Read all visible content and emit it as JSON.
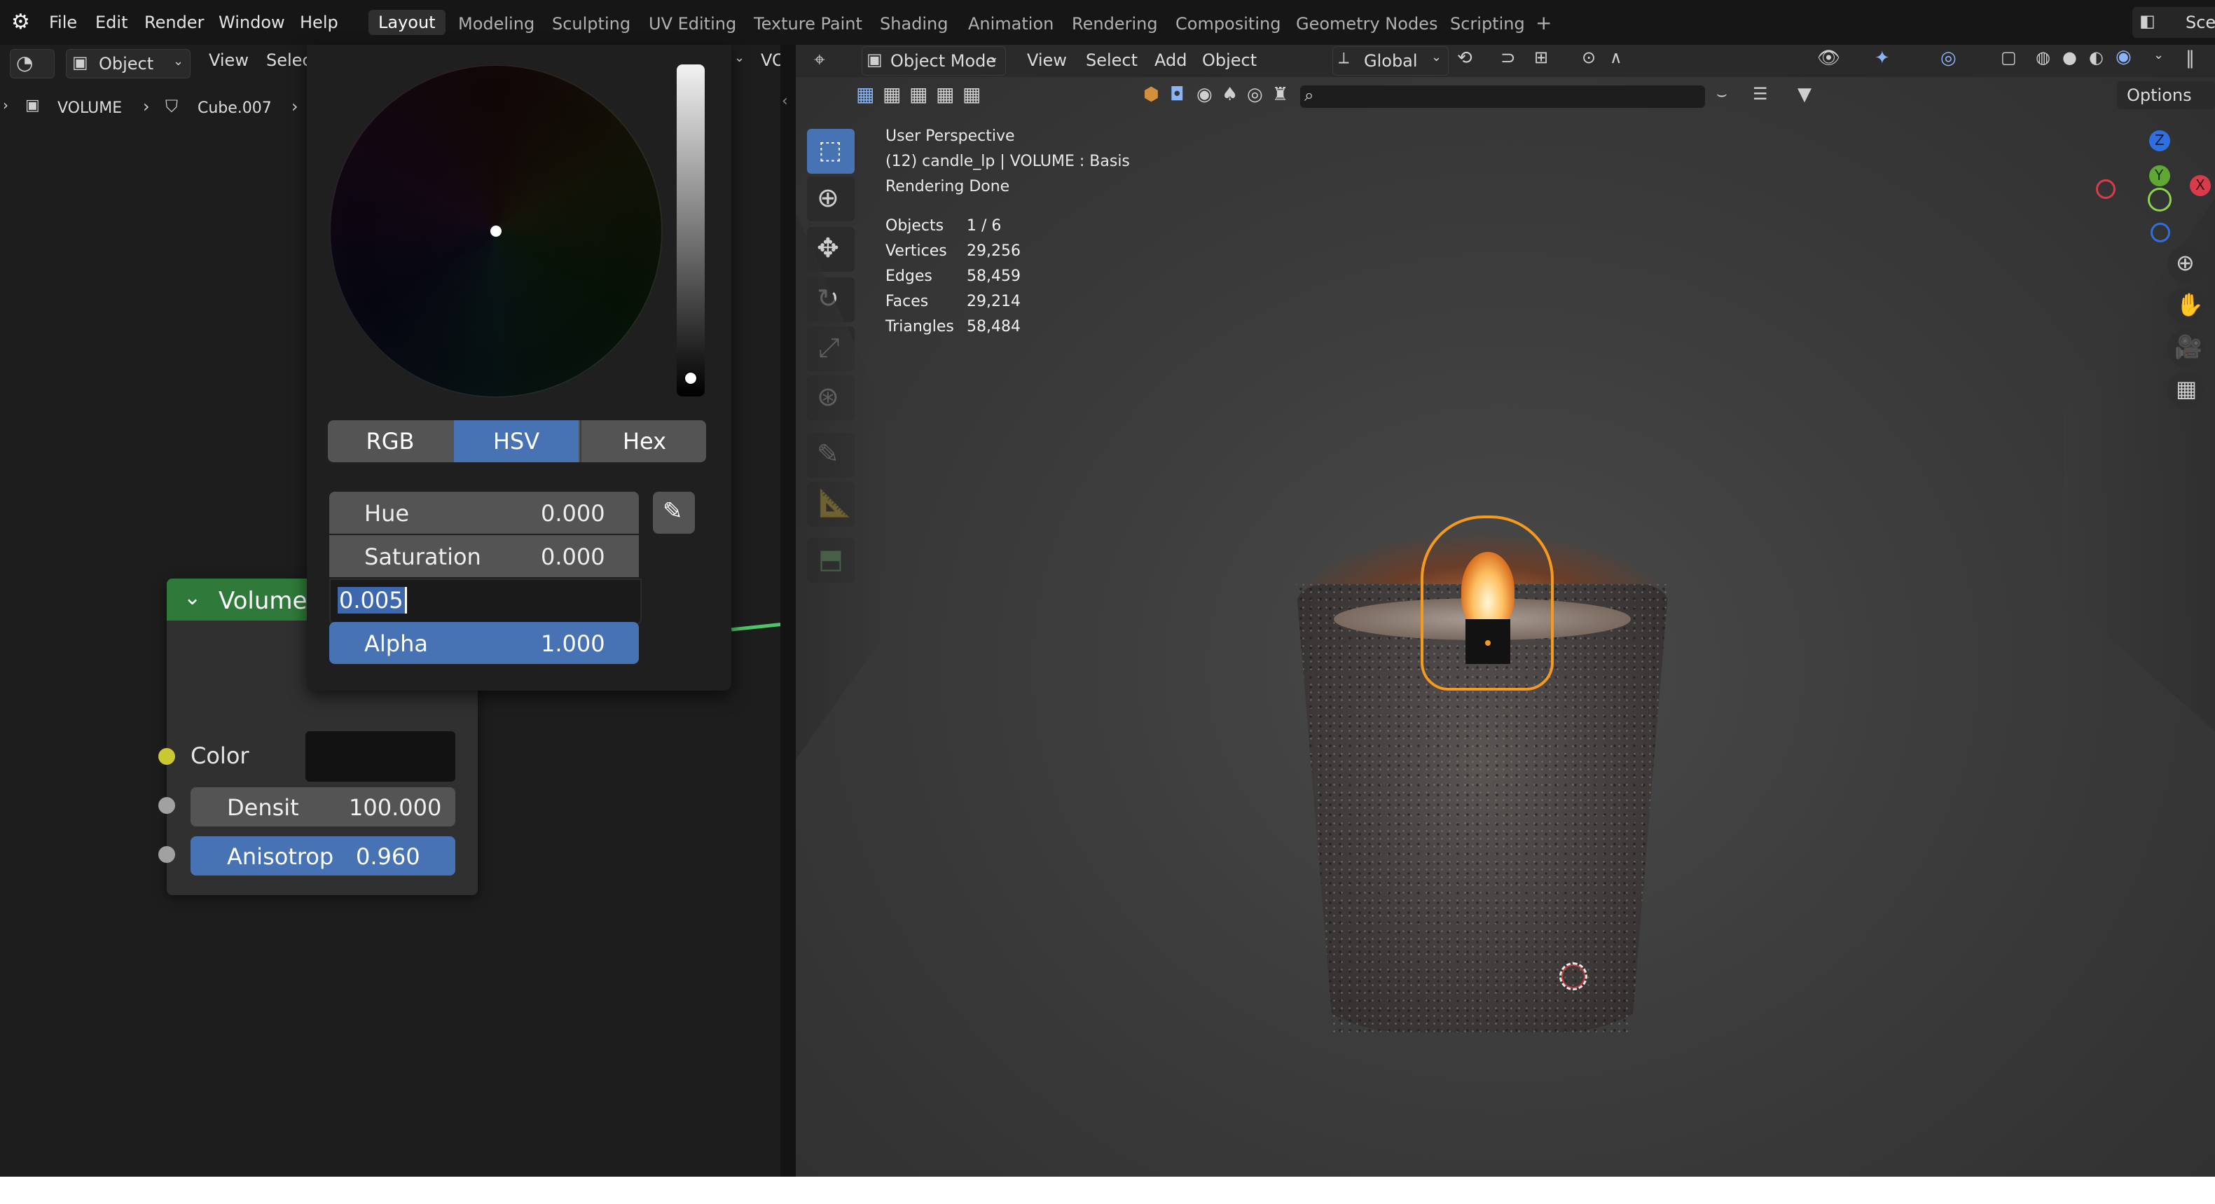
{
  "topbar": {
    "menu": [
      "File",
      "Edit",
      "Render",
      "Window",
      "Help"
    ],
    "workspaces": [
      "Layout",
      "Modeling",
      "Sculpting",
      "UV Editing",
      "Texture Paint",
      "Shading",
      "Animation",
      "Rendering",
      "Compositing",
      "Geometry Nodes",
      "Scripting"
    ],
    "active_workspace": "Layout",
    "add_label": "+",
    "scene_label": "Sce"
  },
  "node_editor": {
    "header": {
      "object_dropdown": "Object",
      "view": "View",
      "select": "Selec",
      "vol": "VOL"
    },
    "breadcrumb": {
      "volume": "VOLUME",
      "object": "Cube.007"
    },
    "node": {
      "title": "Volume",
      "color_label": "Color",
      "density_label": "Densit",
      "density_value": "100.000",
      "anisotropy_label": "Anisotrop",
      "anisotropy_value": "0.960"
    }
  },
  "color_picker": {
    "modes": [
      "RGB",
      "HSV",
      "Hex"
    ],
    "active_mode": "HSV",
    "hue_label": "Hue",
    "hue_value": "0.000",
    "saturation_label": "Saturation",
    "saturation_value": "0.000",
    "value_editing": "0.005",
    "alpha_label": "Alpha",
    "alpha_value": "1.000"
  },
  "viewport": {
    "header": {
      "mode": "Object Mode",
      "view": "View",
      "select": "Select",
      "add": "Add",
      "object": "Object",
      "orientation": "Global",
      "options": "Options"
    },
    "overlay": {
      "line1": "User Perspective",
      "line2": "(12) candle_lp | VOLUME : Basis",
      "line3": "Rendering Done"
    },
    "stats": [
      {
        "label": "Objects",
        "value": "1 / 6"
      },
      {
        "label": "Vertices",
        "value": "29,256"
      },
      {
        "label": "Edges",
        "value": "58,459"
      },
      {
        "label": "Faces",
        "value": "29,214"
      },
      {
        "label": "Triangles",
        "value": "58,484"
      }
    ],
    "gizmo": {
      "z": "Z",
      "y": "Y",
      "x": "X"
    }
  }
}
